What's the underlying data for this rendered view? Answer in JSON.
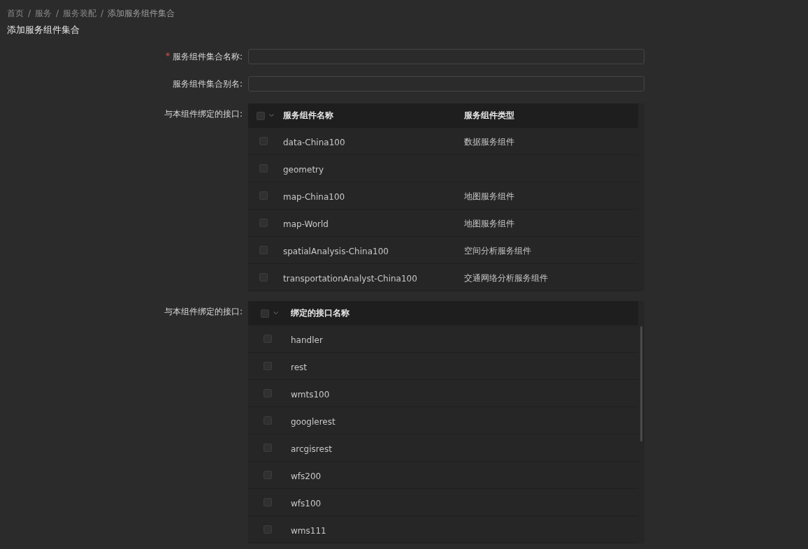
{
  "breadcrumb": [
    {
      "kind": "link",
      "text": "首页"
    },
    {
      "kind": "separator",
      "text": "/"
    },
    {
      "kind": "link",
      "text": "服务"
    },
    {
      "kind": "separator",
      "text": "/"
    },
    {
      "kind": "link",
      "text": "服务装配"
    },
    {
      "kind": "separator",
      "text": "/"
    },
    {
      "kind": "current",
      "text": "添加服务组件集合"
    }
  ],
  "page_title": "添加服务组件集合",
  "fields": [
    {
      "label": "服务组件集合名称:",
      "required_mark": "*"
    },
    {
      "label": "服务组件集合别名:"
    }
  ],
  "components_table": {
    "label": "与本组件绑定的接口:",
    "select_all": {
      "checked": false
    },
    "columns": [
      "服务组件名称",
      "服务组件类型"
    ],
    "rows": [
      {
        "cells": [
          "data-China100",
          "数据服务组件"
        ],
        "checked": false
      },
      {
        "cells": [
          "geometry",
          ""
        ],
        "checked": false
      },
      {
        "cells": [
          "map-China100",
          "地图服务组件"
        ],
        "checked": false
      },
      {
        "cells": [
          "map-World",
          "地图服务组件"
        ],
        "checked": false
      },
      {
        "cells": [
          "spatialAnalysis-China100",
          "空间分析服务组件"
        ],
        "checked": false
      },
      {
        "cells": [
          "transportationAnalyst-China100",
          "交通网络分析服务组件"
        ],
        "checked": false
      }
    ]
  },
  "interfaces_table": {
    "label": "与本组件绑定的接口:",
    "select_all": {
      "checked": false
    },
    "columns": [
      "绑定的接口名称"
    ],
    "rows": [
      {
        "cells": [
          "handler"
        ],
        "checked": false
      },
      {
        "cells": [
          "rest"
        ],
        "checked": false
      },
      {
        "cells": [
          "wmts100"
        ],
        "checked": false
      },
      {
        "cells": [
          "googlerest"
        ],
        "checked": false
      },
      {
        "cells": [
          "arcgisrest"
        ],
        "checked": false
      },
      {
        "cells": [
          "wfs200"
        ],
        "checked": false
      },
      {
        "cells": [
          "wfs100"
        ],
        "checked": false
      },
      {
        "cells": [
          "wms111"
        ],
        "checked": false
      }
    ]
  }
}
